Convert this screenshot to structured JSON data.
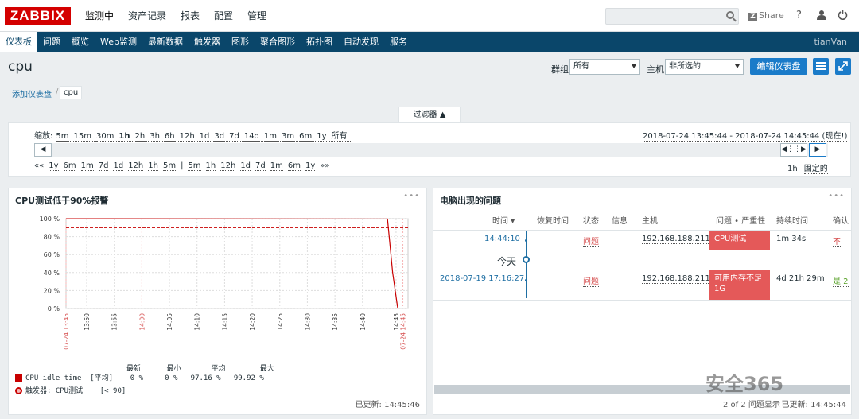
{
  "header": {
    "logo": "ZABBIX",
    "menu": [
      "监测中",
      "资产记录",
      "报表",
      "配置",
      "管理"
    ],
    "share": "Share",
    "help_icon": "?",
    "user_icon": "user-icon",
    "power_icon": "power-icon"
  },
  "subnav": {
    "items": [
      "仪表板",
      "问题",
      "概览",
      "Web监测",
      "最新数据",
      "触发器",
      "图形",
      "聚合图形",
      "拓扑图",
      "自动发现",
      "服务"
    ],
    "user": "tianVan"
  },
  "page": {
    "title": "cpu",
    "group_label": "群组",
    "group_value": "所有",
    "host_label": "主机",
    "host_value": "非所选的",
    "edit_button": "编辑仪表盘",
    "breadcrumb_add": "添加仪表盘",
    "breadcrumb_current": "cpu"
  },
  "filter": {
    "tab": "过滤器 ▲",
    "zoom_label": "缩放:",
    "zoom_options": [
      "5m",
      "15m",
      "30m",
      "1h",
      "2h",
      "3h",
      "6h",
      "12h",
      "1d",
      "3d",
      "7d",
      "14d",
      "1m",
      "3m",
      "6m",
      "1y",
      "所有"
    ],
    "zoom_selected": "1h",
    "range_text": "2018-07-24 13:45:44 - 2018-07-24 14:45:44 (现在!)",
    "nav_left": [
      "««",
      "1y",
      "6m",
      "1m",
      "7d",
      "1d",
      "12h",
      "1h",
      "5m",
      "|",
      "5m",
      "1h",
      "12h",
      "1d",
      "7d",
      "1m",
      "6m",
      "1y",
      "»»"
    ],
    "period": "1h",
    "fixed": "固定的"
  },
  "graph_widget": {
    "title": "CPU测试低于90%报警",
    "updated": "已更新: 14:45:46",
    "legend_header": "最新      最小       平均        最大",
    "legend_item": "CPU idle time  [平均]    0 %     0 %   97.16 %   99.92 %",
    "legend_trigger": "触发器: CPU测试    [< 90]"
  },
  "chart_data": {
    "type": "line",
    "y_ticks": [
      "100 %",
      "80 %",
      "60 %",
      "40 %",
      "20 %",
      "0 %"
    ],
    "ylim": [
      0,
      100
    ],
    "x_ticks": [
      "07-24 13:45",
      "13:50",
      "13:55",
      "14:00",
      "14:05",
      "14:10",
      "14:15",
      "14:20",
      "14:25",
      "14:30",
      "14:35",
      "14:40",
      "14:45",
      "07-24 14:45"
    ],
    "x_ticks_red": [
      true,
      false,
      false,
      true,
      false,
      false,
      false,
      false,
      false,
      false,
      false,
      false,
      false,
      true
    ],
    "series": [
      {
        "name": "CPU idle time",
        "color": "#c80000",
        "points": [
          [
            0,
            99.9
          ],
          [
            0.94,
            99.6
          ],
          [
            0.955,
            40
          ],
          [
            0.97,
            0
          ]
        ]
      }
    ],
    "trigger": {
      "name": "CPU测试",
      "value": 90,
      "color": "#c80000"
    }
  },
  "problems_widget": {
    "title": "电脑出现的问题",
    "columns": [
      "时间 ▾",
      "恢复时间",
      "状态",
      "信息",
      "主机",
      "问题 • 严重性",
      "持续时间",
      "确认"
    ],
    "today_label": "今天",
    "rows": [
      {
        "time": "14:44:10",
        "status": "问题",
        "host": "192.168.188.211",
        "problem": "CPU测试",
        "duration": "1m 34s",
        "ack": "不"
      },
      {
        "time": "2018-07-19 17:16:27",
        "status": "问题",
        "host": "192.168.188.211",
        "problem": "可用内存不足1G",
        "duration": "4d 21h 29m",
        "ack": "是 2"
      }
    ],
    "footer_count": "2 of 2 问题显示",
    "updated": "已更新: 14:45:44"
  },
  "watermark": "安全365"
}
